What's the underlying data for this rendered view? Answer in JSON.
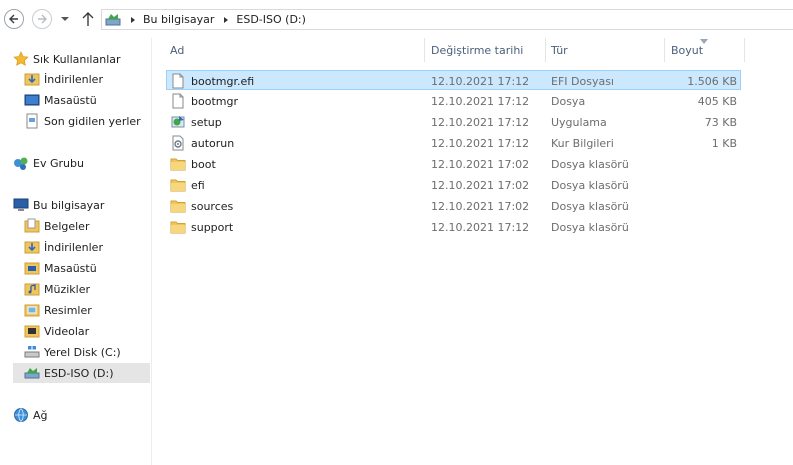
{
  "window": {
    "title": "ESD-ISO (D:)"
  },
  "address": {
    "crumbs": [
      "Bu bilgisayar",
      "ESD-ISO (D:)"
    ]
  },
  "nav": {
    "favorites_label": "Sık Kullanılanlar",
    "favorites": [
      "İndirilenler",
      "Masaüstü",
      "Son gidilen yerler"
    ],
    "homegroup_label": "Ev Grubu",
    "pc_label": "Bu bilgisayar",
    "pc_items": [
      "Belgeler",
      "İndirilenler",
      "Masaüstü",
      "Müzikler",
      "Resimler",
      "Videolar",
      "Yerel Disk (C:)",
      "ESD-ISO (D:)"
    ],
    "network_label": "Ağ"
  },
  "columns": {
    "name": "Ad",
    "date": "Değiştirme tarihi",
    "type": "Tür",
    "size": "Boyut"
  },
  "files": [
    {
      "name": "bootmgr.efi",
      "date": "12.10.2021 17:12",
      "type": "EFI Dosyası",
      "size": "1.506 KB",
      "icon": "blank-file-icon"
    },
    {
      "name": "bootmgr",
      "date": "12.10.2021 17:12",
      "type": "Dosya",
      "size": "405 KB",
      "icon": "blank-file-icon"
    },
    {
      "name": "setup",
      "date": "12.10.2021 17:12",
      "type": "Uygulama",
      "size": "73 KB",
      "icon": "setup-app-icon"
    },
    {
      "name": "autorun",
      "date": "12.10.2021 17:12",
      "type": "Kur Bilgileri",
      "size": "1 KB",
      "icon": "settings-file-icon"
    },
    {
      "name": "boot",
      "date": "12.10.2021 17:02",
      "type": "Dosya klasörü",
      "size": "",
      "icon": "folder-icon"
    },
    {
      "name": "efi",
      "date": "12.10.2021 17:02",
      "type": "Dosya klasörü",
      "size": "",
      "icon": "folder-icon"
    },
    {
      "name": "sources",
      "date": "12.10.2021 17:02",
      "type": "Dosya klasörü",
      "size": "",
      "icon": "folder-icon"
    },
    {
      "name": "support",
      "date": "12.10.2021 17:12",
      "type": "Dosya klasörü",
      "size": "",
      "icon": "folder-icon"
    }
  ],
  "colors": {
    "selection": "#cce8ff",
    "selection_border": "#99d1ff",
    "folder": "#f2c55c",
    "header_text": "#4c607a"
  }
}
